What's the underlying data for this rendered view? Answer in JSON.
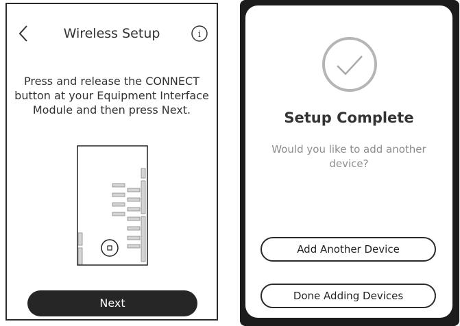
{
  "left_screen": {
    "title": "Wireless Setup",
    "instructions": "Press and release the CONNECT button at your Equipment Interface Module and then press Next.",
    "next_label": "Next",
    "icons": {
      "back": "chevron-left-icon",
      "info": "info-icon"
    }
  },
  "right_screen": {
    "title": "Setup Complete",
    "question": "Would you like to add another device?",
    "add_label": "Add Another Device",
    "done_label": "Done Adding Devices",
    "icons": {
      "status": "check-circle-icon"
    }
  },
  "colors": {
    "primary_button": "#262626",
    "text_dark": "#333333",
    "text_muted": "#8d8d8d",
    "device_frame": "#1c1c1c"
  }
}
